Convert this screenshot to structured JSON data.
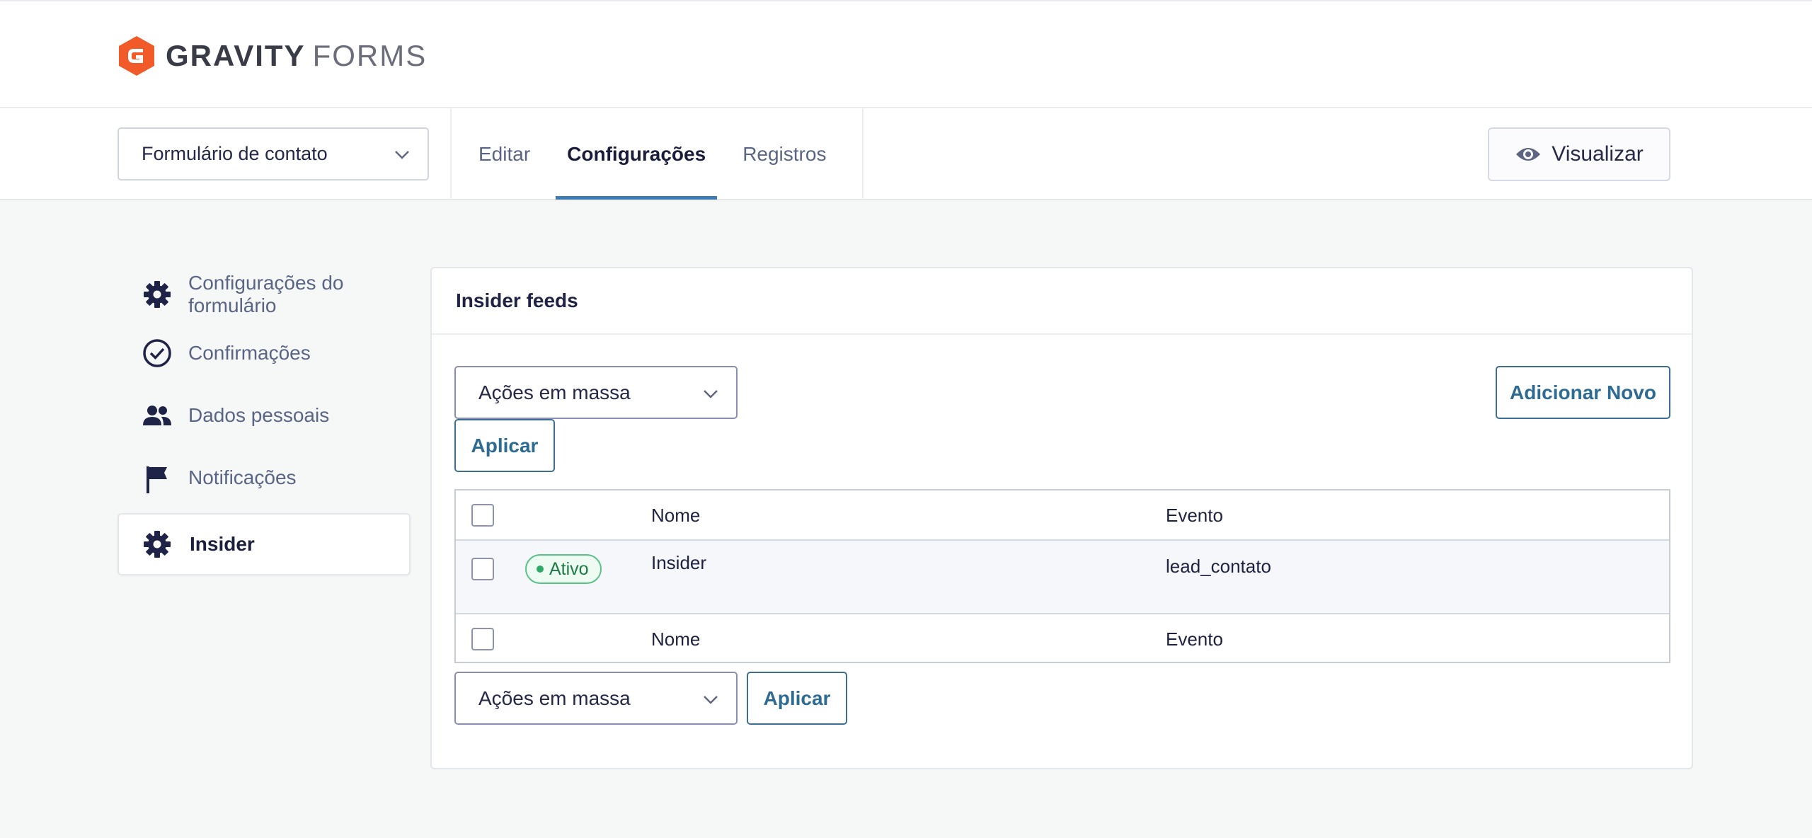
{
  "brand": {
    "name_bold": "GRAVITY",
    "name_light": "FORMS",
    "accent_color": "#f15a29"
  },
  "toolbar": {
    "form_selector": {
      "selected": "Formulário de contato"
    },
    "tabs": [
      {
        "label": "Editar",
        "active": false
      },
      {
        "label": "Configurações",
        "active": true
      },
      {
        "label": "Registros",
        "active": false
      }
    ],
    "preview_label": "Visualizar"
  },
  "sidebar": {
    "items": [
      {
        "label": "Configurações do formulário",
        "icon": "gear-icon"
      },
      {
        "label": "Confirmações",
        "icon": "check-circle-icon"
      },
      {
        "label": "Dados pessoais",
        "icon": "users-icon"
      },
      {
        "label": "Notificações",
        "icon": "flag-icon"
      },
      {
        "label": "Insider",
        "icon": "gear-icon",
        "active": true
      }
    ]
  },
  "panel": {
    "title": "Insider feeds",
    "bulk_actions": {
      "top": "Ações em massa",
      "bottom": "Ações em massa"
    },
    "apply_label": "Aplicar",
    "add_new_label": "Adicionar Novo",
    "table": {
      "columns": [
        "Nome",
        "Evento"
      ],
      "rows": [
        {
          "status": "Ativo",
          "name": "Insider",
          "event": "lead_contato"
        }
      ],
      "footer_columns": [
        "Nome",
        "Evento"
      ]
    }
  }
}
